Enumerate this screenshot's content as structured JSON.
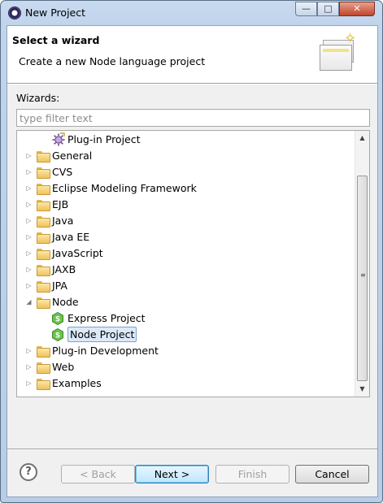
{
  "window": {
    "title": "New Project"
  },
  "title_buttons": {
    "minimize": "—",
    "maximize": "□",
    "close": "✕"
  },
  "banner": {
    "title": "Select a wizard",
    "description": "Create a new Node language project"
  },
  "wizards_label": "Wizards:",
  "filter": {
    "placeholder": "type filter text",
    "value": ""
  },
  "tree": {
    "items": [
      {
        "label": "Plug-in Project",
        "icon": "plugin-project-icon",
        "expanded": null,
        "depth": 1
      },
      {
        "label": "General",
        "icon": "folder-icon",
        "expanded": false,
        "depth": 0
      },
      {
        "label": "CVS",
        "icon": "folder-icon",
        "expanded": false,
        "depth": 0
      },
      {
        "label": "Eclipse Modeling Framework",
        "icon": "folder-icon",
        "expanded": false,
        "depth": 0
      },
      {
        "label": "EJB",
        "icon": "folder-icon",
        "expanded": false,
        "depth": 0
      },
      {
        "label": "Java",
        "icon": "folder-icon",
        "expanded": false,
        "depth": 0
      },
      {
        "label": "Java EE",
        "icon": "folder-icon",
        "expanded": false,
        "depth": 0
      },
      {
        "label": "JavaScript",
        "icon": "folder-icon",
        "expanded": false,
        "depth": 0
      },
      {
        "label": "JAXB",
        "icon": "folder-icon",
        "expanded": false,
        "depth": 0
      },
      {
        "label": "JPA",
        "icon": "folder-icon",
        "expanded": false,
        "depth": 0
      },
      {
        "label": "Node",
        "icon": "folder-icon",
        "expanded": true,
        "depth": 0
      },
      {
        "label": "Express Project",
        "icon": "nodejs-icon",
        "expanded": null,
        "depth": 1
      },
      {
        "label": "Node Project",
        "icon": "nodejs-icon",
        "expanded": null,
        "depth": 1,
        "selected": true
      },
      {
        "label": "Plug-in Development",
        "icon": "folder-icon",
        "expanded": false,
        "depth": 0
      },
      {
        "label": "Web",
        "icon": "folder-icon",
        "expanded": false,
        "depth": 0
      },
      {
        "label": "Examples",
        "icon": "folder-icon",
        "expanded": false,
        "depth": 0
      }
    ]
  },
  "buttons": {
    "back": "< Back",
    "next": "Next >",
    "finish": "Finish",
    "cancel": "Cancel",
    "help": "?"
  }
}
